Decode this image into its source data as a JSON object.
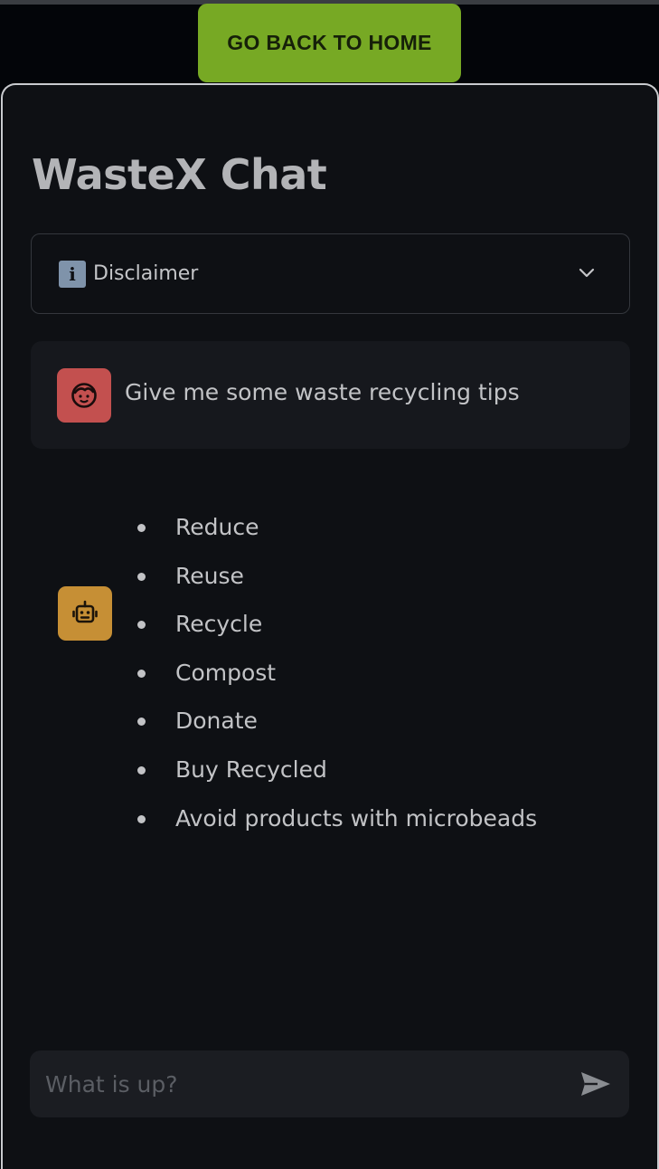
{
  "nav": {
    "home_label": "GO BACK TO HOME"
  },
  "page": {
    "title": "WasteX Chat"
  },
  "disclaimer": {
    "icon_glyph": "i",
    "label": "Disclaimer"
  },
  "messages": {
    "user": {
      "text": "Give me some waste recycling tips"
    },
    "assistant": {
      "items": [
        "Reduce",
        "Reuse",
        "Recycle",
        "Compost",
        "Donate",
        "Buy Recycled",
        "Avoid products with microbeads"
      ]
    }
  },
  "chat_input": {
    "placeholder": "What is up?"
  },
  "icons": {
    "info": "info-icon",
    "chevron": "chevron-down-icon",
    "user_avatar": "face-icon",
    "bot_avatar": "robot-icon",
    "send": "send-icon"
  },
  "colors": {
    "home_button": "#77a924",
    "user_avatar": "#c3504f",
    "bot_avatar": "#c68f35",
    "panel_bg": "#0e1014",
    "page_bg": "#030509"
  }
}
